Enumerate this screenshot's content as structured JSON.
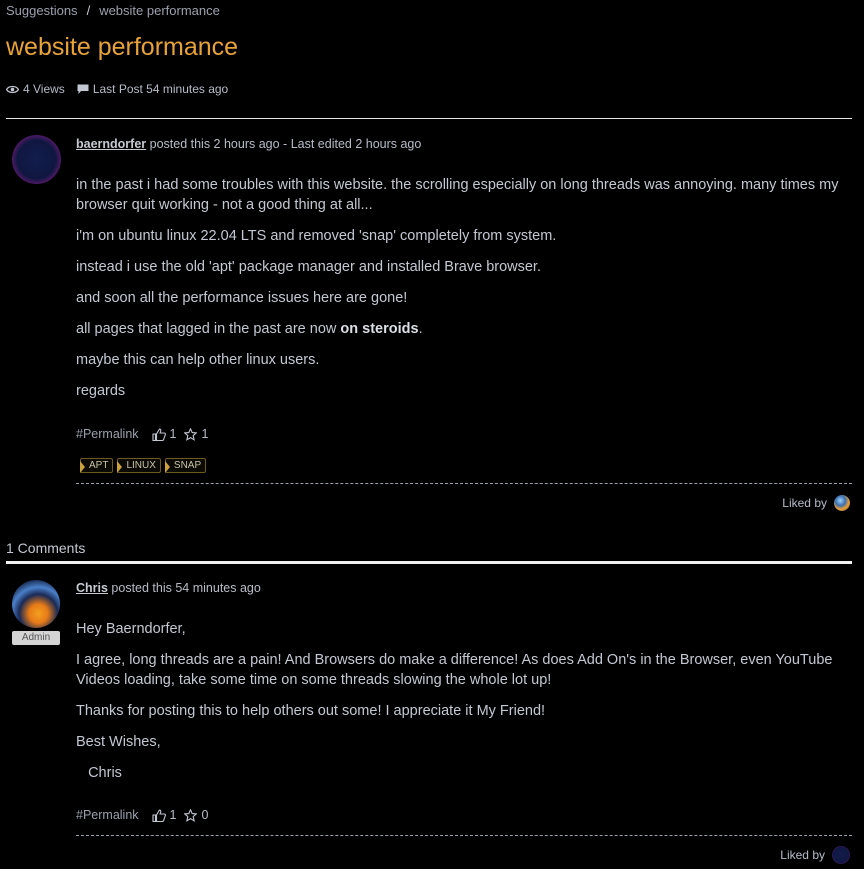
{
  "breadcrumb": {
    "parent": "Suggestions",
    "separator": "/",
    "current": "website performance"
  },
  "title": "website performance",
  "meta": {
    "views": "4 Views",
    "last_post": "Last Post 54 minutes ago"
  },
  "post": {
    "author": "baerndorfer",
    "byline_rest": " posted this 2 hours ago - Last edited 2 hours ago",
    "paragraphs": [
      "in the past i had some troubles with this website. the scrolling especially on long threads was annoying. many times my browser quit working - not a good thing at all...",
      "i'm on ubuntu linux 22.04 LTS and removed 'snap' completely from system.",
      "instead i use the old 'apt' package manager and installed Brave browser.",
      "and soon all the performance issues here are gone!"
    ],
    "p5_before": "all pages that lagged in the past are now ",
    "p5_bold": "on steroids",
    "p5_after": ".",
    "paragraphs_tail": [
      "maybe this can help other linux users.",
      "regards"
    ],
    "permalink": "#Permalink",
    "likes": "1",
    "stars": "1",
    "tags": [
      "APT",
      "LINUX",
      "SNAP"
    ],
    "liked_by": "Liked by"
  },
  "comments_count": "1 Comments",
  "comment": {
    "author": "Chris",
    "byline_rest": " posted this 54 minutes ago",
    "badge": "Admin",
    "paragraphs": [
      "Hey Baerndorfer,",
      "I agree, long threads are a pain! And Browsers do make a difference! As does Add On's in the Browser, even YouTube Videos loading, take some time on some threads slowing the whole lot up!",
      "Thanks for posting this to help others out some! I appreciate it My Friend!",
      "Best Wishes,",
      "   Chris"
    ],
    "permalink": "#Permalink",
    "likes": "1",
    "stars": "0",
    "liked_by": "Liked by"
  },
  "icons": {
    "views": "eye-icon",
    "last_post": "speech-bubble-icon",
    "like": "thumbs-up-icon",
    "star": "star-icon"
  },
  "colors": {
    "accent": "#e8a23a",
    "background": "#000000",
    "text": "#c4c8d2"
  }
}
